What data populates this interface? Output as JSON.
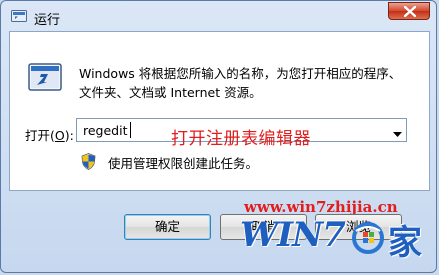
{
  "window": {
    "title": "运行",
    "icon": "run-app-icon",
    "close_icon": "close-icon"
  },
  "dialog": {
    "description": "Windows 将根据您所输入的名称，为您打开相应的程序、文件夹、文档或 Internet 资源。",
    "open_label_prefix": "打开(",
    "open_label_hotkey": "O",
    "open_label_suffix": "):",
    "input_value": "regedit",
    "dropdown_icon": "chevron-down-icon",
    "admin_notice": "使用管理权限创建此任务。",
    "admin_icon": "uac-shield-icon"
  },
  "annotation": {
    "text": "打开注册表编辑器",
    "color": "#e11d1d"
  },
  "buttons": {
    "ok": "确定",
    "cancel": "取消",
    "browse": "浏览"
  },
  "watermark": {
    "url": "www.win7zhijia.cn",
    "logo_text": "WIN7",
    "logo_zh": "家",
    "color": "#1f5fbf"
  }
}
